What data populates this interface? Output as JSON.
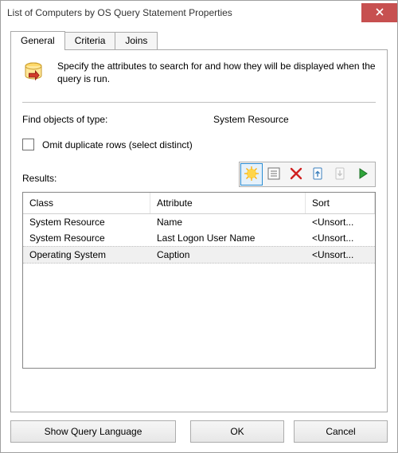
{
  "window": {
    "title": "List of Computers by OS Query Statement Properties"
  },
  "tabs": {
    "general": "General",
    "criteria": "Criteria",
    "joins": "Joins",
    "active": 0
  },
  "intro": "Specify the attributes to search for and how they will be displayed when the query is run.",
  "findObjects": {
    "label": "Find objects of type:",
    "value": "System Resource"
  },
  "omit": {
    "label": "Omit duplicate rows (select distinct)",
    "checked": false
  },
  "results": {
    "label": "Results:",
    "columns": {
      "class": "Class",
      "attribute": "Attribute",
      "sort": "Sort"
    },
    "rows": [
      {
        "class": "System Resource",
        "attribute": "Name",
        "sort": "<Unsort..."
      },
      {
        "class": "System Resource",
        "attribute": "Last Logon User Name",
        "sort": "<Unsort..."
      },
      {
        "class": "Operating System",
        "attribute": "Caption",
        "sort": "<Unsort...",
        "selected": true
      }
    ],
    "toolbar": {
      "new": {
        "name": "new-icon",
        "enabled": true,
        "selected": true
      },
      "edit": {
        "name": "properties-icon",
        "enabled": true
      },
      "delete": {
        "name": "delete-icon",
        "enabled": true
      },
      "moveUp": {
        "name": "move-up-icon",
        "enabled": true
      },
      "moveDown": {
        "name": "move-down-icon",
        "enabled": false
      },
      "run": {
        "name": "run-icon",
        "enabled": true
      }
    }
  },
  "buttons": {
    "showQuery": "Show Query Language",
    "ok": "OK",
    "cancel": "Cancel"
  }
}
